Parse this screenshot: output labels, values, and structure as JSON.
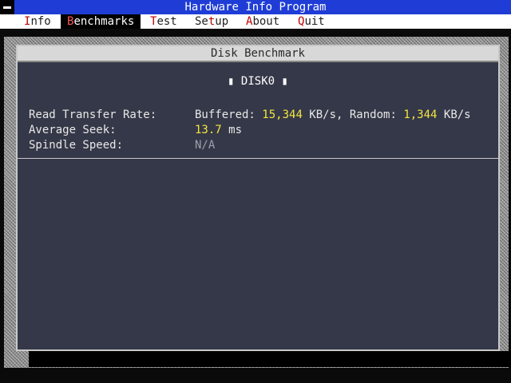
{
  "app": {
    "title": "Hardware Info Program"
  },
  "menu": [
    {
      "hotkey": "I",
      "rest": "nfo",
      "active": false
    },
    {
      "hotkey": "B",
      "rest": "enchmarks",
      "active": true
    },
    {
      "hotkey": "T",
      "rest": "est",
      "active": false
    },
    {
      "pre": "Se",
      "hotkey": "t",
      "rest": "up",
      "active": false
    },
    {
      "hotkey": "A",
      "rest": "bout",
      "active": false
    },
    {
      "hotkey": "Q",
      "rest": "uit",
      "active": false
    }
  ],
  "window": {
    "title": "Disk Benchmark",
    "disk_label": "▮ DISK0 ▮"
  },
  "results": {
    "read_label": "Read Transfer Rate:",
    "buffered_label": "Buffered: ",
    "buffered_value": "15,344",
    "buffered_unit": " KB/s, Random: ",
    "random_value": "1,344",
    "random_unit": " KB/s",
    "seek_label": "Average Seek:",
    "seek_value": "13.7",
    "seek_unit": " ms",
    "spindle_label": "Spindle Speed:",
    "spindle_value": "N/A"
  },
  "colors": {
    "titlebar": "#1f3dd6",
    "window_bg": "#353848",
    "highlight_value": "#f2e640",
    "hotkey": "#c00000"
  }
}
